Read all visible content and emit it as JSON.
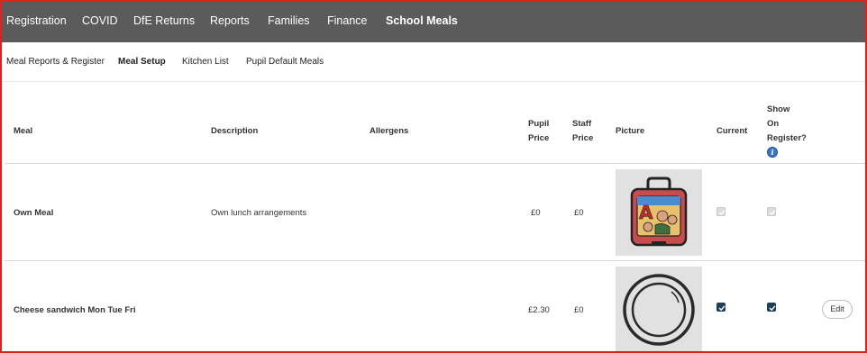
{
  "top_nav": {
    "items": [
      {
        "label": "Registration"
      },
      {
        "label": "COVID"
      },
      {
        "label": "DfE Returns"
      },
      {
        "label": "Reports"
      },
      {
        "label": "Families"
      },
      {
        "label": "Finance"
      },
      {
        "label": "School Meals",
        "active": true
      }
    ]
  },
  "sub_nav": {
    "items": [
      {
        "label": "Meal Reports & Register"
      },
      {
        "label": "Meal Setup",
        "active": true
      },
      {
        "label": "Kitchen List"
      },
      {
        "label": "Pupil Default Meals"
      }
    ]
  },
  "table": {
    "headers": {
      "meal": "Meal",
      "description": "Description",
      "allergens": "Allergens",
      "pupil_price_line1": "Pupil",
      "pupil_price_line2": "Price",
      "staff_price_line1": "Staff",
      "staff_price_line2": "Price",
      "picture": "Picture",
      "current": "Current",
      "show_line1": "Show",
      "show_line2": "On",
      "show_line3": "Register?"
    },
    "rows": [
      {
        "meal": "Own Meal",
        "description": "Own lunch arrangements",
        "allergens": "",
        "pupil_price": "£0",
        "staff_price": "£0",
        "picture_icon": "lunchbox-icon",
        "current": true,
        "current_disabled": true,
        "show_on_register": true,
        "show_disabled": true
      },
      {
        "meal": "Cheese sandwich Mon Tue Fri",
        "description": "",
        "allergens": "",
        "pupil_price": "£2.30",
        "staff_price": "£0",
        "picture_icon": "plate-icon",
        "current": true,
        "current_disabled": false,
        "show_on_register": true,
        "show_disabled": false,
        "edit_label": "Edit"
      }
    ]
  },
  "colors": {
    "top_nav_bg": "#5b5b5b",
    "frame_border": "#e02020",
    "checkbox_checked": "#1d3f55",
    "info_icon": "#3a76c9"
  }
}
